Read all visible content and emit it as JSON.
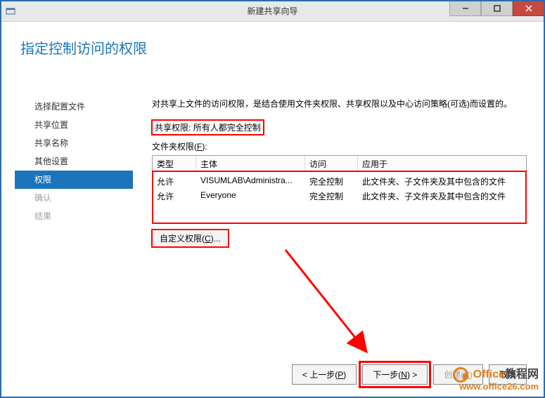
{
  "window": {
    "title": "新建共享向导"
  },
  "heading": "指定控制访问的权限",
  "sidebar": {
    "items": [
      {
        "label": "选择配置文件"
      },
      {
        "label": "共享位置"
      },
      {
        "label": "共享名称"
      },
      {
        "label": "其他设置"
      },
      {
        "label": "权限"
      },
      {
        "label": "确认"
      },
      {
        "label": "结果"
      }
    ]
  },
  "main": {
    "desc": "对共享上文件的访问权限，是结合使用文件夹权限、共享权限以及中心访问策略(可选)而设置的。",
    "share_label": "共享权限:",
    "share_value": "所有人都完全控制",
    "folder_label_pre": "文件夹权限(",
    "folder_label_key": "F",
    "folder_label_post": "):",
    "columns": {
      "type": "类型",
      "principal": "主体",
      "access": "访问",
      "applies": "应用于"
    },
    "rows": [
      {
        "type": "允许",
        "principal": "VISUMLAB\\Administra...",
        "access": "完全控制",
        "applies": "此文件夹、子文件夹及其中包含的文件"
      },
      {
        "type": "允许",
        "principal": "Everyone",
        "access": "完全控制",
        "applies": "此文件夹、子文件夹及其中包含的文件"
      }
    ],
    "custom_btn_pre": "自定义权限(",
    "custom_btn_key": "C",
    "custom_btn_post": ")..."
  },
  "footer": {
    "prev_pre": "< 上一步(",
    "prev_key": "P",
    "prev_post": ")",
    "next_pre": "下一步(",
    "next_key": "N",
    "next_post": ") >",
    "create_pre": "创建(",
    "create_key": "C",
    "create_post": ")",
    "cancel": "取消"
  },
  "watermark": {
    "brand1": "Office",
    "brand2": "教程网",
    "url": "www.office26.com"
  }
}
